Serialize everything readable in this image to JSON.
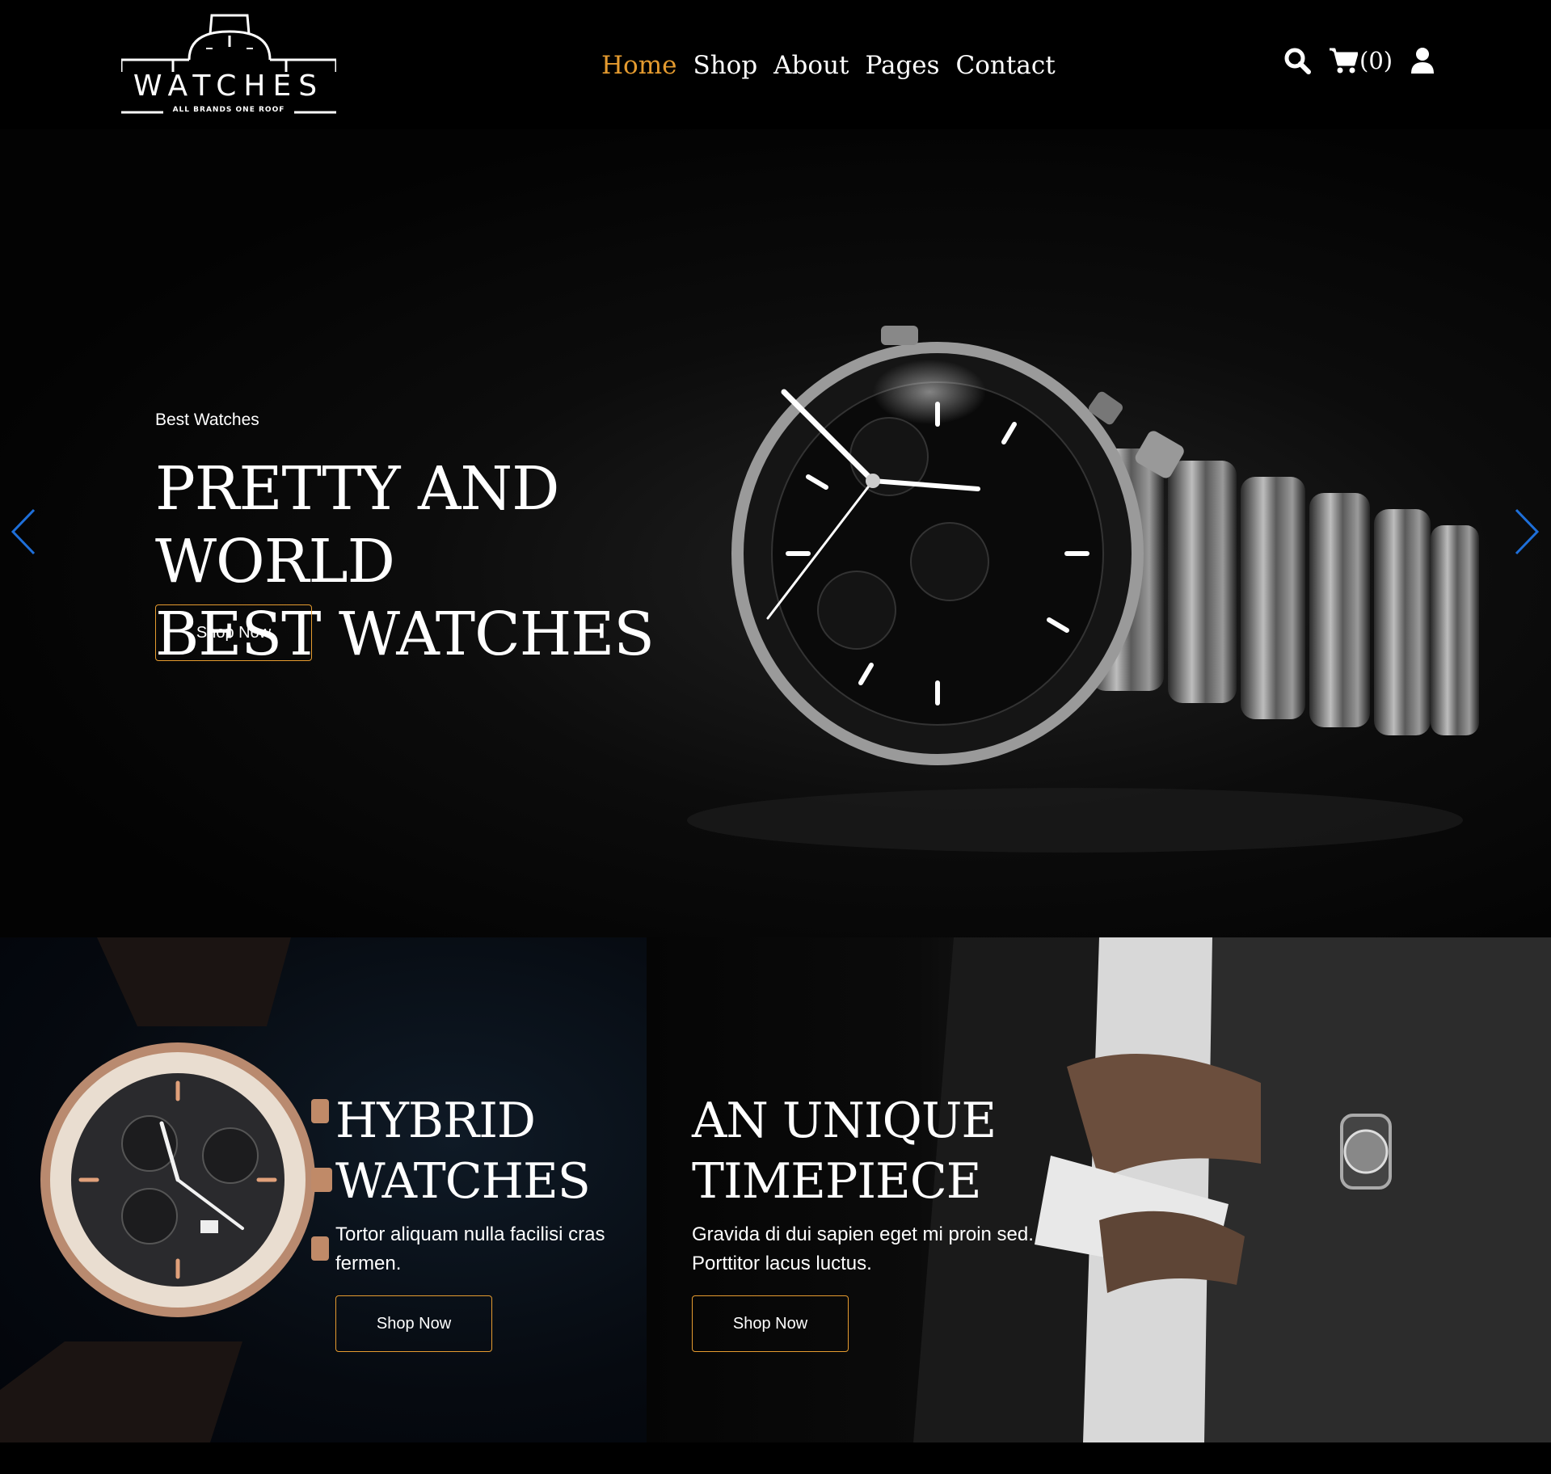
{
  "brand": {
    "name": "WATCHES",
    "tagline": "ALL BRANDS ONE ROOF",
    "accent_color": "#e59b2f"
  },
  "nav": {
    "items": [
      {
        "label": "Home",
        "active": true
      },
      {
        "label": "Shop",
        "active": false
      },
      {
        "label": "About",
        "active": false
      },
      {
        "label": "Pages",
        "active": false
      },
      {
        "label": "Contact",
        "active": false
      }
    ]
  },
  "header_icons": {
    "search": "search-icon",
    "cart": "cart-icon",
    "cart_count": "(0)",
    "user": "user-icon"
  },
  "hero": {
    "subtitle": "Best Watches",
    "title_line1": "PRETTY AND WORLD",
    "title_line2": "BEST WATCHES",
    "button": "Shop Now",
    "arrow_color": "#1e6fd9"
  },
  "promos": [
    {
      "title_line1": "HYBRID",
      "title_line2": "WATCHES",
      "text_line1": "Tortor aliquam nulla facilisi cras",
      "text_line2": "fermen.",
      "button": "Shop Now"
    },
    {
      "title_line1": "AN UNIQUE",
      "title_line2": "TIMEPIECE",
      "text_line1": "Gravida di dui sapien eget mi proin sed.",
      "text_line2": "Porttitor lacus luctus.",
      "button": "Shop Now"
    }
  ]
}
